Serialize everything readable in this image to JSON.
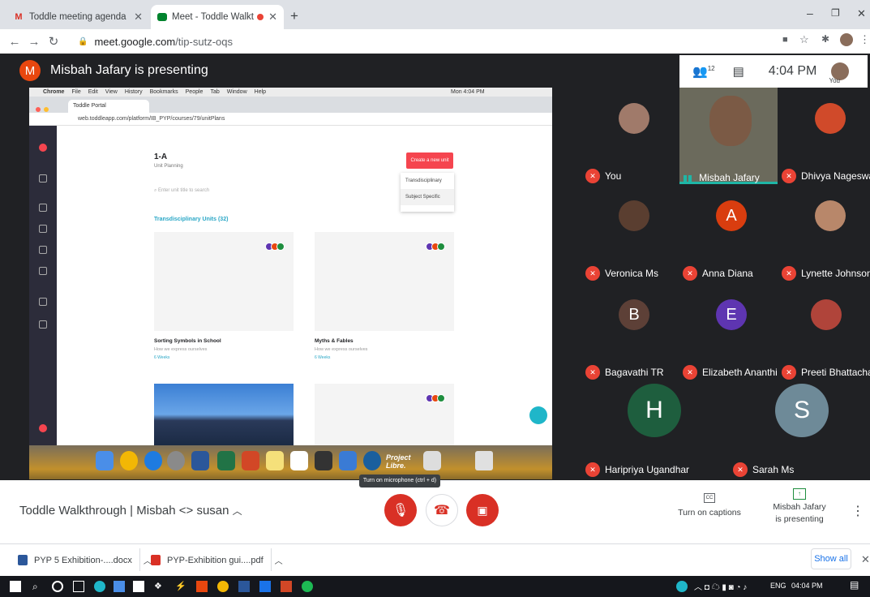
{
  "browser": {
    "tabs": [
      {
        "title": "Toddle meeting agenda - susan@",
        "icon": "gmail-icon",
        "active": false
      },
      {
        "title": "Meet - Toddle Walkthrough",
        "icon": "meet-icon",
        "active": true
      }
    ],
    "new_tab": "+",
    "url_host": "meet.google.com",
    "url_path": "/tip-sutz-oqs"
  },
  "meet": {
    "presenter_initial": "M",
    "presenter_label": "Misbah Jafary is presenting",
    "participant_count": "12",
    "clock": "4:04 PM",
    "self_label": "You",
    "participants": [
      {
        "name": "You",
        "initial": "",
        "color": "#a07a6a"
      },
      {
        "name": "Misbah Jafary",
        "initial": "",
        "color": "#6b6a5c"
      },
      {
        "name": "Dhivya Nageswari",
        "initial": "",
        "color": "#d04a2a"
      },
      {
        "name": "Veronica Ms",
        "initial": "",
        "color": "#5a3e30"
      },
      {
        "name": "Anna Diana",
        "initial": "A",
        "color": "#d93d0f"
      },
      {
        "name": "Lynette Johnson",
        "initial": "",
        "color": "#b8876a"
      },
      {
        "name": "Bagavathi TR",
        "initial": "B",
        "color": "#5d4037"
      },
      {
        "name": "Elizabeth Ananthi",
        "initial": "E",
        "color": "#5e35b1"
      },
      {
        "name": "Preeti Bhattacharya",
        "initial": "",
        "color": "#b0443a"
      },
      {
        "name": "Haripriya Ugandhar",
        "initial": "H",
        "color": "#1e5e3e"
      },
      {
        "name": "Sarah Ms",
        "initial": "S",
        "color": "#6e8a98"
      }
    ],
    "meeting_title": "Toddle Walkthrough | Misbah <> susan",
    "tooltip": "Turn on microphone (ctrl + d)",
    "captions_label": "Turn on captions",
    "presenting_label": "Misbah Jafary is presenting"
  },
  "shared_screen": {
    "mac_menu": [
      "Chrome",
      "File",
      "Edit",
      "View",
      "History",
      "Bookmarks",
      "People",
      "Tab",
      "Window",
      "Help"
    ],
    "mac_clock": "Mon 4:04 PM",
    "inner_tab": "Toddle Portal",
    "inner_url": "web.toddleapp.com/platform/IB_PYP/courses/79/unitPlans",
    "unit_title": "1-A",
    "unit_sub": "Unit Planning",
    "search_placeholder": "Enter unit title to search",
    "create_button": "Create a new unit",
    "dropdown": [
      "Transdisciplinary",
      "Subject Specific"
    ],
    "section_title": "Transdisciplinary Units (32)",
    "cards": [
      {
        "name": "Sorting Symbols in School",
        "theme": "How we express ourselves",
        "weeks": "6 Weeks"
      },
      {
        "name": "Myths & Fables",
        "theme": "How we express ourselves",
        "weeks": "6 Weeks"
      }
    ],
    "dock_text": "Project Libre."
  },
  "downloads": [
    {
      "name": "PYP 5 Exhibition-....docx",
      "icon": "word-doc-icon"
    },
    {
      "name": "PYP-Exhibition gui....pdf",
      "icon": "pdf-icon"
    }
  ],
  "show_all": "Show all",
  "taskbar": {
    "lang": "ENG",
    "time": "04:04 PM"
  }
}
